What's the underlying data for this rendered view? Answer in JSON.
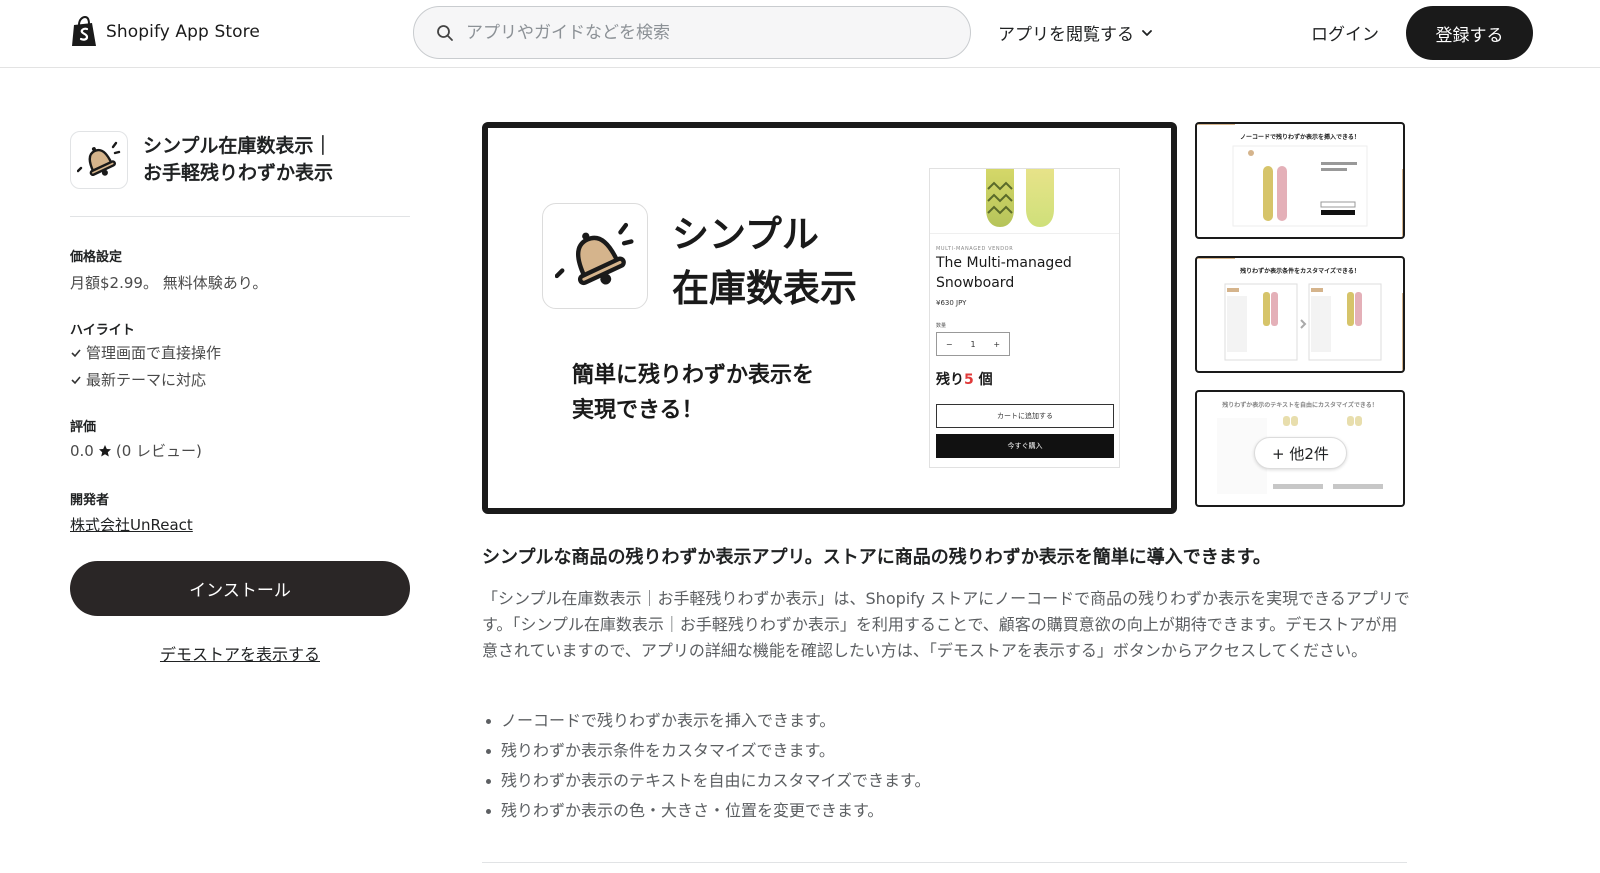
{
  "header": {
    "brand": "Shopify App Store",
    "search_placeholder": "アプリやガイドなどを検索",
    "browse_label": "アプリを閲覧する",
    "login_label": "ログイン",
    "signup_label": "登録する"
  },
  "app": {
    "title_line1": "シンプル在庫数表示｜",
    "title_line2": "お手軽残りわずか表示",
    "pricing_label": "価格設定",
    "pricing_value": "月額$2.99。 無料体験あり。",
    "highlights_label": "ハイライト",
    "highlights": [
      "管理画面で直接操作",
      "最新テーマに対応"
    ],
    "rating_label": "評価",
    "rating_value": "0.0",
    "rating_reviews": "(0 レビュー)",
    "developer_label": "開発者",
    "developer_name": "株式会社UnReact",
    "install_label": "インストール",
    "demo_label": "デモストアを表示する"
  },
  "hero": {
    "title_line1": "シンプル",
    "title_line2": "在庫数表示",
    "sub_line1": "簡単に残りわずか表示を",
    "sub_line2": "実現できる！",
    "product": {
      "vendor": "MULTI-MANAGED VENDOR",
      "name": "The Multi-managed Snowboard",
      "price": "¥630 JPY",
      "qty_label": "数量",
      "qty_minus": "−",
      "qty_value": "1",
      "qty_plus": "+",
      "remain_prefix": "残り",
      "remain_num": "5",
      "remain_suffix": " 個",
      "add_to_cart": "カートに追加する",
      "buy_now": "今すぐ購入"
    }
  },
  "thumbnails": {
    "t1_title": "ノーコードで残りわずか表示を挿入できる！",
    "t2_title": "残りわずか表示条件をカスタマイズできる！",
    "t3_title": "残りわずか表示のテキストを自由にカスタマイズできる！",
    "more_label": "+ 他2件"
  },
  "description": {
    "headline": "シンプルな商品の残りわずか表示アプリ。ストアに商品の残りわずか表示を簡単に導入できます。",
    "body": "「シンプル在庫数表示｜お手軽残りわずか表示」は、Shopify ストアにノーコードで商品の残りわずか表示を実現できるアプリです。「シンプル在庫数表示｜お手軽残りわずか表示」を利用することで、顧客の購買意欲の向上が期待できます。デモストアが用意されていますので、アプリの詳細な機能を確認したい方は、「デモストアを表示する」ボタンからアクセスしてください。",
    "features": [
      "ノーコードで残りわずか表示を挿入できます。",
      "残りわずか表示条件をカスタマイズできます。",
      "残りわずか表示のテキストを自由にカスタマイズできます。",
      " 残りわずか表示の色・大きさ・位置を変更できます。"
    ]
  },
  "colors": {
    "accent_tan": "#d5b48c",
    "dark": "#1a1a1a",
    "remain_red": "#e03a3a"
  }
}
